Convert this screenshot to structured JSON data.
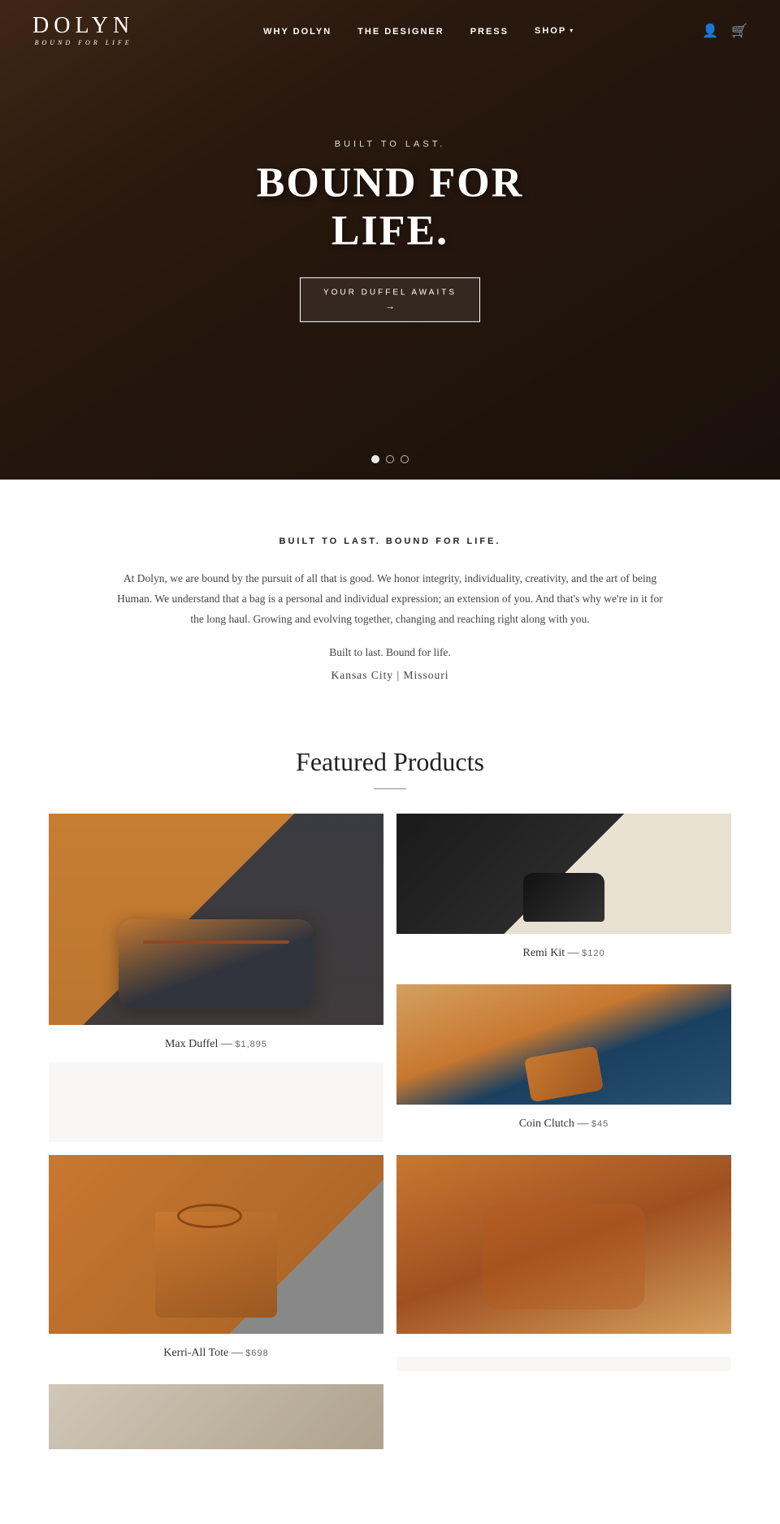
{
  "brand": {
    "name": "DOLYN",
    "tagline": "BOUND FOR LIFE"
  },
  "nav": {
    "links": [
      {
        "id": "why-dolyn",
        "label": "WHY DOLYN"
      },
      {
        "id": "the-designer",
        "label": "THE DESIGNER"
      },
      {
        "id": "press",
        "label": "PRESS"
      },
      {
        "id": "shop",
        "label": "SHOP"
      }
    ],
    "user_icon": "👤",
    "cart_icon": "🛒",
    "shop_arrow": "▾"
  },
  "hero": {
    "subtitle": "BUILT TO LAST.",
    "title": "BOUND FOR LIFE.",
    "cta_label": "YOUR DUFFEL AWAITS",
    "cta_arrow": "→",
    "dots": [
      {
        "active": true
      },
      {
        "active": false
      },
      {
        "active": false
      }
    ]
  },
  "about": {
    "title": "BUILT TO LAST. BOUND FOR LIFE.",
    "body": "At Dolyn, we are bound by the pursuit of all that is good. We honor integrity, individuality, creativity, and the art of being Human. We understand that a bag is a personal and individual expression; an extension of you.  And that's why we're in it for the long haul. Growing and evolving together, changing and reaching right along with you.",
    "tagline": "Built to last. Bound for life.",
    "location": "Kansas City  |  Missouri"
  },
  "featured": {
    "section_title": "Featured Products",
    "products": [
      {
        "id": "max-duffel",
        "name": "Max Duffel",
        "price": "$1,895",
        "size": "large",
        "img_class": "img-max-duffel"
      },
      {
        "id": "remi-kit",
        "name": "Remi Kit",
        "price": "$120",
        "size": "small",
        "img_class": "img-remi-kit"
      },
      {
        "id": "coin-clutch",
        "name": "Coin Clutch",
        "price": "$45",
        "size": "small",
        "img_class": "img-coin-clutch"
      },
      {
        "id": "kerri-tote",
        "name": "Kerri-All Tote",
        "price": "$698",
        "size": "bottom",
        "img_class": "img-kerri-tote"
      },
      {
        "id": "brown-duffel",
        "name": "",
        "price": "",
        "size": "bottom",
        "img_class": "img-bottom-bag"
      }
    ]
  }
}
